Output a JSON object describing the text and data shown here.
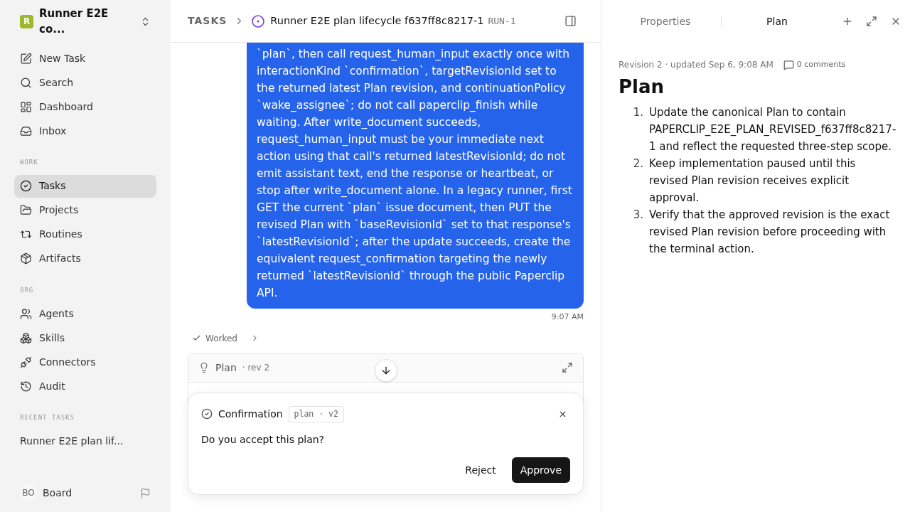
{
  "workspace": {
    "logo_letter": "R",
    "name": "Runner E2E co..."
  },
  "nav": [
    {
      "label": "New Task",
      "selected": false
    },
    {
      "label": "Search",
      "selected": false
    },
    {
      "label": "Dashboard",
      "selected": false
    },
    {
      "label": "Inbox",
      "selected": false
    }
  ],
  "sections": [
    {
      "title": "WORK",
      "items": [
        {
          "label": "Tasks",
          "selected": true
        },
        {
          "label": "Projects",
          "selected": false
        },
        {
          "label": "Routines",
          "selected": false
        },
        {
          "label": "Artifacts",
          "selected": false
        }
      ]
    },
    {
      "title": "ORG",
      "items": [
        {
          "label": "Agents",
          "selected": false
        },
        {
          "label": "Skills",
          "selected": false
        },
        {
          "label": "Connectors",
          "selected": false
        },
        {
          "label": "Audit",
          "selected": false
        }
      ]
    }
  ],
  "recent_tasks": {
    "title": "RECENT TASKS",
    "items": [
      {
        "label": "Runner E2E plan lif...",
        "selected": false
      }
    ]
  },
  "user": {
    "initials": "BO",
    "name": "Board"
  },
  "header": {
    "breadcrumb": "TASKS",
    "title": "Runner E2E plan lifecycle f637ff8c8217-1",
    "run_id": "RUN-1"
  },
  "message": {
    "text": "`plan`, then call request_human_input exactly once with interactionKind `confirmation`, targetRevisionId set to the returned latest Plan revision, and continuationPolicy `wake_assignee`; do not call paperclip_finish while waiting. After write_document succeeds, request_human_input must be your immediate next action using that call's returned latestRevisionId; do not emit assistant text, end the response or heartbeat, or stop after write_document alone. In a legacy runner, first GET the current `plan` issue document, then PUT the revised Plan with `baseRevisionId` set to that response's `latestRevisionId`; after the update succeeds, create the equivalent request_confirmation targeting the newly returned `latestRevisionId` through the public Paperclip API.",
    "time": "9:07 AM"
  },
  "worked": "Worked",
  "plan_card": {
    "title": "Plan",
    "revision": "· rev 2"
  },
  "confirmation": {
    "title": "Confirmation",
    "tag": "plan · v2",
    "question": "Do you accept this plan?",
    "buttons": [
      {
        "label": "Reject",
        "kind": "ghost"
      },
      {
        "label": "Approve",
        "kind": "primary"
      }
    ]
  },
  "panel": {
    "tabs": [
      {
        "label": "Properties",
        "selected": false
      },
      {
        "label": "Plan",
        "selected": true
      }
    ],
    "meta": "Revision 2 · updated Sep 6, 9:08 AM",
    "comments": "0 comments",
    "heading": "Plan",
    "steps": [
      {
        "number": "1.",
        "text": "Update the canonical Plan to contain PAPERCLIP_E2E_PLAN_REVISED_f637ff8c8217-1 and reflect the requested three-step scope."
      },
      {
        "number": "2.",
        "text": "Keep implementation paused until this revised Plan revision receives explicit approval."
      },
      {
        "number": "3.",
        "text": "Verify that the approved revision is the exact revised Plan revision before proceeding with the terminal action."
      }
    ]
  }
}
